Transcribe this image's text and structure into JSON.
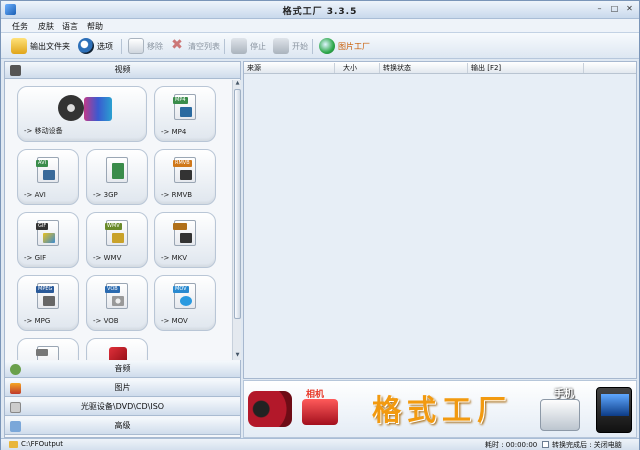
{
  "window": {
    "title": "格式工厂  3.3.5",
    "min": "–",
    "max": "□",
    "close": "✕"
  },
  "menu": [
    "任务",
    "皮肤",
    "语言",
    "帮助"
  ],
  "toolbar": {
    "output_folder": "输出文件夹",
    "options": "选项",
    "remove": "移除",
    "clear_list": "清空列表",
    "stop": "停止",
    "start": "开始",
    "picture_factory": "图片工厂"
  },
  "categories": {
    "video": "视频",
    "audio": "音频",
    "picture": "图片",
    "rom": "光驱设备\\DVD\\CD\\ISO",
    "advanced": "高级"
  },
  "video_tiles": [
    {
      "label": "-> 移动设备",
      "tag": "",
      "tag_color": "#444444"
    },
    {
      "label": "-> MP4",
      "tag": "MP4",
      "tag_color": "#3a8c4a"
    },
    {
      "label": "-> AVI",
      "tag": "AVI",
      "tag_color": "#3a8c4a"
    },
    {
      "label": "-> 3GP",
      "tag": "",
      "tag_color": "#3a8c4a"
    },
    {
      "label": "-> RMVB",
      "tag": "RMVB",
      "tag_color": "#d0781a"
    },
    {
      "label": "-> GIF",
      "tag": "GIF",
      "tag_color": "#333333"
    },
    {
      "label": "-> WMV",
      "tag": "WMV",
      "tag_color": "#6a8a2a"
    },
    {
      "label": "-> MKV",
      "tag": "",
      "tag_color": "#b0701a"
    },
    {
      "label": "-> MPG",
      "tag": "MPEG",
      "tag_color": "#2a5a9a"
    },
    {
      "label": "-> VOB",
      "tag": "VOB",
      "tag_color": "#2a6ab0"
    },
    {
      "label": "-> MOV",
      "tag": "MOV",
      "tag_color": "#2a8ad0"
    }
  ],
  "task_columns": {
    "source": "来源",
    "size": "大小",
    "status": "转换状态",
    "output": "输出 [F2]"
  },
  "banner": {
    "camera_label": "相机",
    "brand": "格式工厂",
    "phone_label": "手机"
  },
  "status": {
    "output_path": "C:\\FFOutput",
    "elapsed": "耗时 : 00:00:00",
    "after_convert": "转换完成后 : 关闭电脑"
  }
}
